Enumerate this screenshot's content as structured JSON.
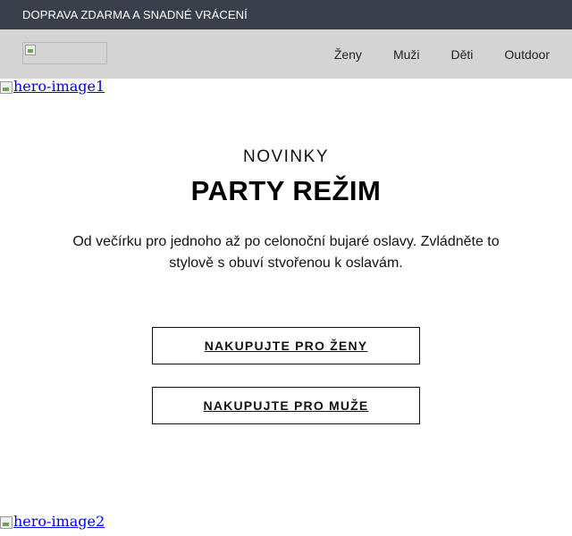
{
  "top_bar": {
    "text": "DOPRAVA ZDARMA A SNADNÉ VRÁCENÍ"
  },
  "nav": {
    "items": [
      {
        "label": "Ženy"
      },
      {
        "label": "Muži"
      },
      {
        "label": "Děti"
      },
      {
        "label": "Outdoor"
      }
    ]
  },
  "hero": {
    "image1_alt": "hero-image1",
    "image2_alt": "hero-image2"
  },
  "content": {
    "eyebrow": "NOVINKY",
    "headline": "PARTY REŽIM",
    "description": "Od večírku pro jednoho až po celonoční bujaré oslavy. Zvládněte to stylově s obuví stvořenou k oslavám."
  },
  "buttons": {
    "women": "NAKUPUJTE PRO ŽENY",
    "men": "NAKUPUJTE PRO MUŽE"
  },
  "colors": {
    "top_bar_bg": "#3a3f4b",
    "nav_bg": "#d4d4d4",
    "link": "#0000ee"
  },
  "icons": {
    "logo": "broken-image-icon",
    "hero": "broken-image-icon"
  }
}
